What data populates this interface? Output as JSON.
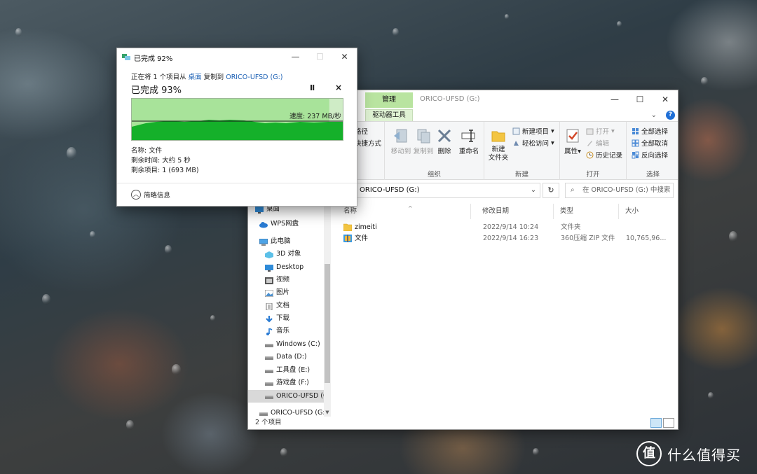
{
  "copy_dialog": {
    "title": "已完成 92%",
    "desc_prefix": "正在将 1 个项目从",
    "desc_source": "桌面",
    "desc_middle": "复制到",
    "desc_destination": "ORICO-UFSD (G:)",
    "progress_title": "已完成 93%",
    "progress_percent": 93,
    "pause_label": "II",
    "cancel_label": "×",
    "speed_label": "速度: 237 MB/秒",
    "name_line": "名称: 文件",
    "time_left_line": "剩余时间: 大约 5 秒",
    "items_left_line": "剩余项目: 1 (693 MB)",
    "more_info_label": "简略信息"
  },
  "explorer": {
    "title": "ORICO-UFSD (G:)",
    "context_tab_head": "管理",
    "context_tab": "驱动器工具",
    "ribbon": {
      "partial_top": "路径",
      "partial_bottom": "快捷方式",
      "organize": {
        "label": "组织",
        "move_to": "移动到",
        "copy_to": "复制到",
        "delete": "删除",
        "rename": "重命名"
      },
      "new": {
        "label": "新建",
        "new_folder_line1": "新建",
        "new_folder_line2": "文件夹",
        "new_item": "新建项目",
        "easy_access": "轻松访问"
      },
      "open": {
        "label": "打开",
        "properties": "属性",
        "open": "打开",
        "edit": "编辑",
        "history": "历史记录"
      },
      "select": {
        "label": "选择",
        "select_all": "全部选择",
        "select_none": "全部取消",
        "invert": "反向选择"
      }
    },
    "address": "ORICO-UFSD (G:)",
    "search_placeholder": "在 ORICO-UFSD (G:) 中搜索",
    "nav": [
      {
        "label": "桌面",
        "icon": "desktop-icon"
      },
      {
        "label": "WPS网盘",
        "icon": "cloud-icon"
      },
      {
        "label": "此电脑",
        "icon": "computer-icon"
      },
      {
        "label": "3D 对象",
        "icon": "cube-icon"
      },
      {
        "label": "Desktop",
        "icon": "desktop-icon"
      },
      {
        "label": "视频",
        "icon": "video-icon"
      },
      {
        "label": "图片",
        "icon": "picture-icon"
      },
      {
        "label": "文档",
        "icon": "document-icon"
      },
      {
        "label": "下载",
        "icon": "download-icon"
      },
      {
        "label": "音乐",
        "icon": "music-icon"
      },
      {
        "label": "Windows (C:)",
        "icon": "drive-icon"
      },
      {
        "label": "Data (D:)",
        "icon": "drive-icon"
      },
      {
        "label": "工具盘 (E:)",
        "icon": "drive-icon"
      },
      {
        "label": "游戏盘 (F:)",
        "icon": "drive-icon"
      },
      {
        "label": "ORICO-UFSD (G:)",
        "icon": "drive-icon"
      },
      {
        "label": "ORICO-UFSD (G:)",
        "icon": "drive-icon"
      }
    ],
    "columns": {
      "name": "名称",
      "modified": "修改日期",
      "type": "类型",
      "size": "大小"
    },
    "files": [
      {
        "name": "zimeiti",
        "modified": "2022/9/14 10:24",
        "type": "文件夹",
        "size": ""
      },
      {
        "name": "文件",
        "modified": "2022/9/14 16:23",
        "type": "360压缩 ZIP 文件",
        "size": "10,765,96..."
      }
    ],
    "status": "2 个项目"
  },
  "watermark": {
    "badge": "值",
    "text": "什么值得买"
  },
  "colors": {
    "graph_fill": "#15b02a",
    "graph_bg": "#cfecc6",
    "context_tab": "#b9e4a0",
    "link": "#1a5fb4"
  }
}
